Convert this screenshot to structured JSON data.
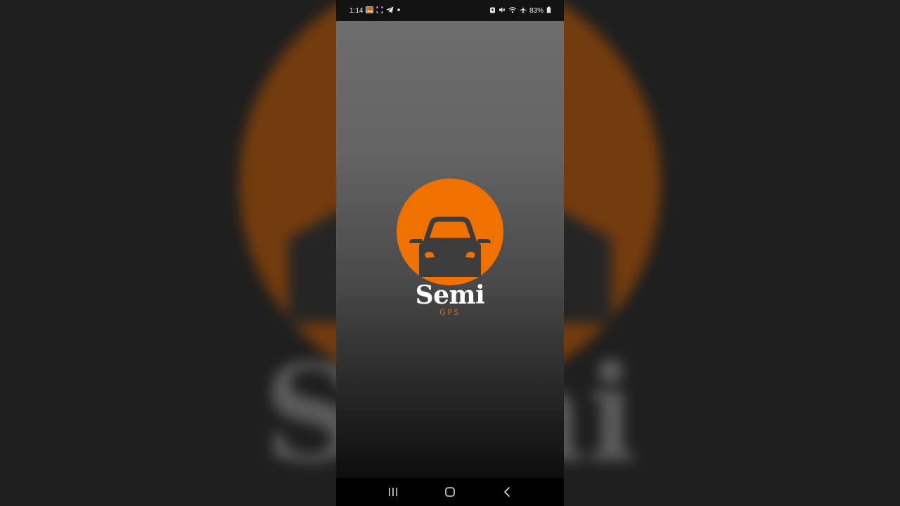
{
  "status_bar": {
    "time": "1:14",
    "battery": "83%",
    "left_icons": [
      "gallery-icon",
      "screenshot-icon",
      "telegram-icon",
      "dot-icon"
    ],
    "right_icons": [
      "alarm-icon",
      "mute-icon",
      "wifi-icon",
      "airplane-icon",
      "battery-icon"
    ]
  },
  "splash": {
    "app_name": "Semi",
    "app_subtitle": "GPS",
    "logo_icon": "car-sun-icon"
  },
  "nav_bar": {
    "recent_icon": "recent-apps-icon",
    "home_icon": "home-icon",
    "back_icon": "back-icon"
  },
  "colors": {
    "brand_orange": "#f07000",
    "logo_dark": "#3c3c3c",
    "subtitle_orange": "#c46a1e",
    "status_bar_bg": "#121212",
    "nav_bar_bg": "#000000"
  }
}
